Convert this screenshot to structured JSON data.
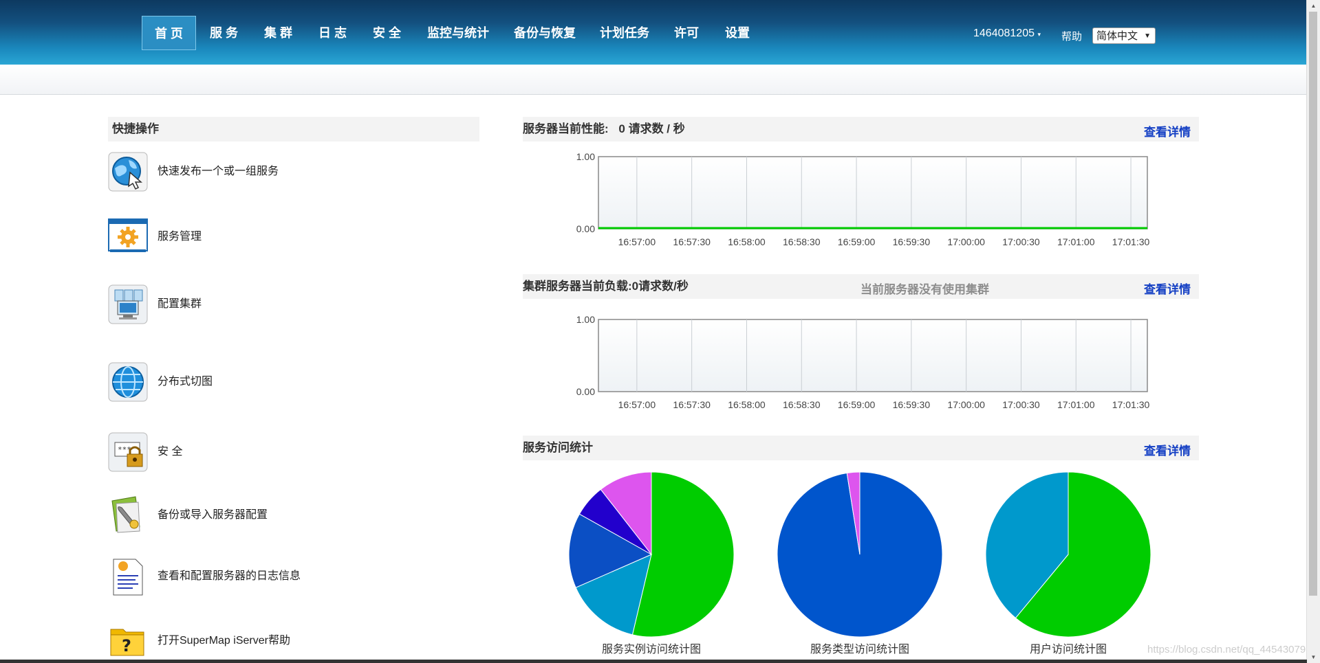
{
  "nav": {
    "items": [
      "首 页",
      "服 务",
      "集 群",
      "日 志",
      "安 全",
      "监控与统计",
      "备份与恢复",
      "计划任务",
      "许可",
      "设置"
    ],
    "active_index": 0,
    "user": "1464081205",
    "help": "帮助",
    "language": "简体中文"
  },
  "quick_ops": {
    "title": "快捷操作",
    "items": [
      {
        "label": "快速发布一个或一组服务",
        "icon": "globe-cursor-icon"
      },
      {
        "label": "服务管理",
        "icon": "gear-window-icon"
      },
      {
        "label": "配置集群",
        "icon": "cluster-computer-icon"
      },
      {
        "label": "分布式切图",
        "icon": "globe-grid-icon"
      },
      {
        "label": "安 全",
        "icon": "lock-password-icon"
      },
      {
        "label": "备份或导入服务器配置",
        "icon": "backup-wrench-icon"
      },
      {
        "label": "查看和配置服务器的日志信息",
        "icon": "log-document-icon"
      },
      {
        "label": "打开SuperMap iServer帮助",
        "icon": "help-folder-icon"
      }
    ]
  },
  "perf": {
    "title": "服务器当前性能:",
    "value": "0 请求数 / 秒",
    "detail_link": "查看详情"
  },
  "cluster": {
    "title": "集群服务器当前负载:",
    "value": "0请求数/秒",
    "note": "当前服务器没有使用集群",
    "detail_link": "查看详情"
  },
  "access": {
    "title": "服务访问统计",
    "detail_link": "查看详情",
    "pie_labels": [
      "服务实例访问统计图",
      "服务类型访问统计图",
      "用户访问统计图"
    ]
  },
  "chart_data": [
    {
      "type": "line",
      "x": [
        "16:57:00",
        "16:57:30",
        "16:58:00",
        "16:58:30",
        "16:59:00",
        "16:59:30",
        "17:00:00",
        "17:00:30",
        "17:01:00",
        "17:01:30"
      ],
      "series": [
        {
          "values": [
            0,
            0,
            0,
            0,
            0,
            0,
            0,
            0,
            0,
            0
          ],
          "color": "#00cc00"
        }
      ],
      "yticks": [
        "1.00",
        "0.00"
      ],
      "ylim": [
        0,
        1
      ],
      "grid": true
    },
    {
      "type": "line",
      "x": [
        "16:57:00",
        "16:57:30",
        "16:58:00",
        "16:58:30",
        "16:59:00",
        "16:59:30",
        "17:00:00",
        "17:00:30",
        "17:01:00",
        "17:01:30"
      ],
      "series": [],
      "yticks": [
        "1.00",
        "0.00"
      ],
      "ylim": [
        0,
        1
      ],
      "grid": true
    },
    {
      "type": "pie",
      "slices": [
        {
          "value": 51,
          "color": "#00cc00"
        },
        {
          "value": 14,
          "color": "#0099cc"
        },
        {
          "value": 14,
          "color": "#0b4fc4"
        },
        {
          "value": 6,
          "color": "#2200cc"
        },
        {
          "value": 10,
          "color": "#dd55ee"
        }
      ]
    },
    {
      "type": "pie",
      "slices": [
        {
          "value": 97.5,
          "color": "#0055cc"
        },
        {
          "value": 2.5,
          "color": "#dd55ee"
        }
      ]
    },
    {
      "type": "pie",
      "slices": [
        {
          "value": 61,
          "color": "#00cc00"
        },
        {
          "value": 39,
          "color": "#0099cc"
        }
      ]
    }
  ],
  "watermark": "https://blog.csdn.net/qq_44543079"
}
